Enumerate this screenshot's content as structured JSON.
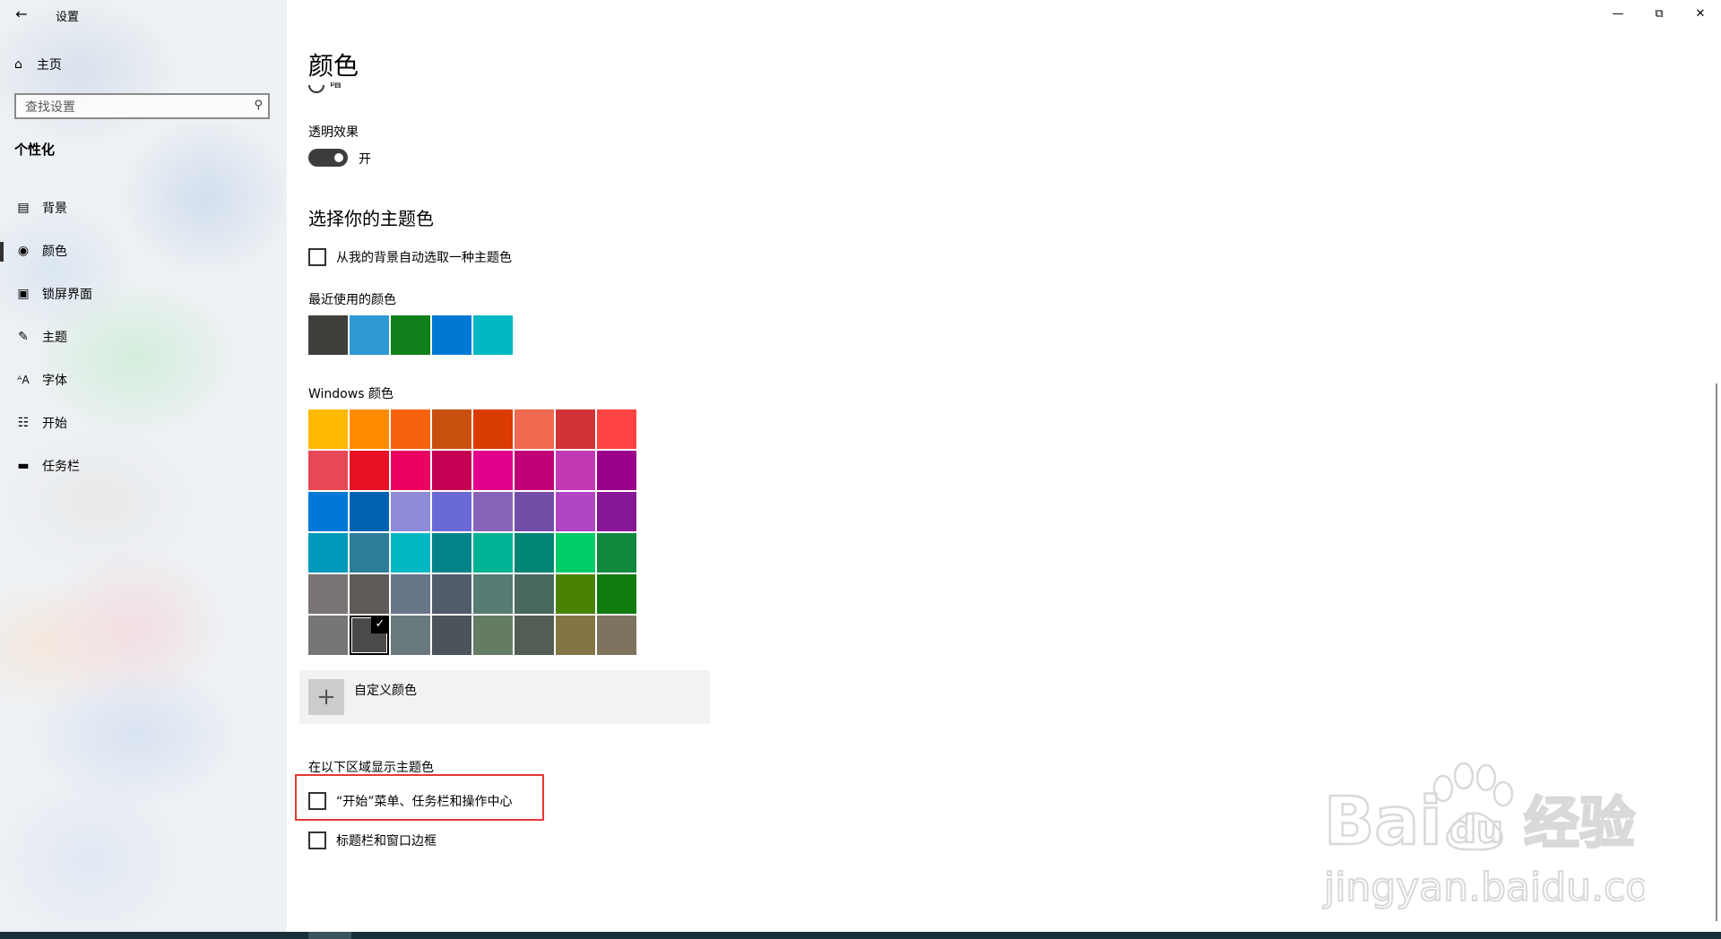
{
  "window": {
    "title": "设置",
    "controls": [
      "minimize",
      "restore",
      "close"
    ]
  },
  "sidebar": {
    "home_label": "主页",
    "search_placeholder": "查找设置",
    "section_title": "个性化",
    "items": [
      {
        "label": "背景",
        "icon": "picture-icon"
      },
      {
        "label": "颜色",
        "icon": "palette-icon",
        "active": true
      },
      {
        "label": "锁屏界面",
        "icon": "lock-screen-icon"
      },
      {
        "label": "主题",
        "icon": "theme-brush-icon"
      },
      {
        "label": "字体",
        "icon": "font-icon"
      },
      {
        "label": "开始",
        "icon": "start-icon"
      },
      {
        "label": "任务栏",
        "icon": "taskbar-icon"
      }
    ]
  },
  "content": {
    "title": "颜色",
    "cut_radio_label": "暗",
    "transparency": {
      "label": "透明效果",
      "state_label": "开",
      "on": true
    },
    "accent_heading": "选择你的主题色",
    "auto_pick_label": "从我的背景自动选取一种主题色",
    "recent": {
      "label": "最近使用的颜色",
      "colors": [
        "#3f3e3b",
        "#2d9ad4",
        "#10801a",
        "#0178d4",
        "#00b7c3"
      ]
    },
    "windows_colors": {
      "label": "Windows 颜色",
      "selected_index": 41,
      "colors": [
        "#ffb900",
        "#ff8c00",
        "#f7630c",
        "#ca5010",
        "#da3b01",
        "#ef6950",
        "#d13438",
        "#ff4343",
        "#e74856",
        "#e81123",
        "#ea005e",
        "#c30052",
        "#e3008c",
        "#bf0077",
        "#c239b3",
        "#9a0089",
        "#0078d7",
        "#0063b1",
        "#8e8cd8",
        "#6b69d6",
        "#8764b8",
        "#744da9",
        "#b146c2",
        "#881798",
        "#0099bc",
        "#2d7d9a",
        "#00b7c3",
        "#038387",
        "#00b294",
        "#018574",
        "#00cc6a",
        "#10893e",
        "#7a7574",
        "#5d5a58",
        "#68768a",
        "#515c6b",
        "#567c73",
        "#486860",
        "#498205",
        "#107c10",
        "#767676",
        "#4c4a48",
        "#69797e",
        "#4a5459",
        "#647c64",
        "#525e54",
        "#847545",
        "#7e735f"
      ]
    },
    "custom_color_label": "自定义颜色",
    "show_accent": {
      "heading": "在以下区域显示主题色",
      "start_taskbar_label": "“开始”菜单、任务栏和操作中心",
      "title_bar_label": "标题栏和窗口边框"
    }
  },
  "watermark": {
    "brand": "Bai",
    "brand_suffix": "du",
    "cn": "经验",
    "url": "jingyan.baidu.com"
  }
}
